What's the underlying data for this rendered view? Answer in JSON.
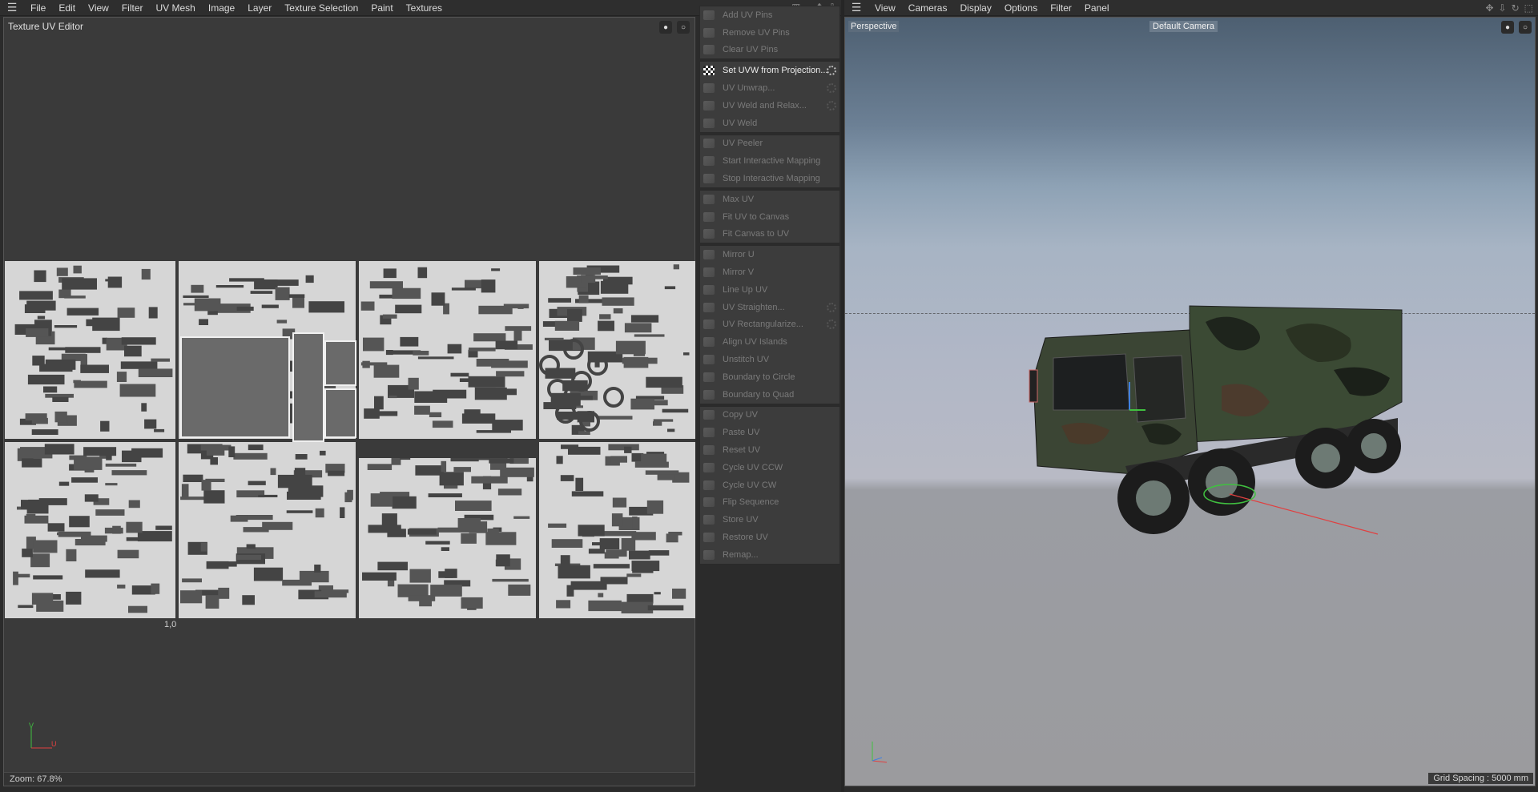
{
  "left_menu": {
    "items": [
      "File",
      "Edit",
      "View",
      "Filter",
      "UV Mesh",
      "Image",
      "Layer",
      "Texture Selection",
      "Paint",
      "Textures"
    ]
  },
  "right_menu": {
    "items": [
      "View",
      "Cameras",
      "Display",
      "Options",
      "Filter",
      "Panel"
    ]
  },
  "uv_editor": {
    "title": "Texture UV Editor",
    "coord_label": "1,0",
    "zoom_text": "Zoom: 67.8%",
    "axis_v": "V",
    "axis_u": "U"
  },
  "commands": {
    "groups": [
      [
        {
          "label": "Add UV Pins"
        },
        {
          "label": "Remove UV Pins"
        },
        {
          "label": "Clear UV Pins"
        }
      ],
      [
        {
          "label": "Set UVW from Projection...",
          "active": true,
          "gear": true
        },
        {
          "label": "UV Unwrap...",
          "gear": true
        },
        {
          "label": "UV Weld and Relax...",
          "gear": true
        },
        {
          "label": "UV Weld"
        }
      ],
      [
        {
          "label": "UV Peeler"
        },
        {
          "label": "Start Interactive Mapping"
        },
        {
          "label": "Stop Interactive Mapping"
        }
      ],
      [
        {
          "label": "Max UV"
        },
        {
          "label": "Fit UV to Canvas"
        },
        {
          "label": "Fit Canvas to UV"
        }
      ],
      [
        {
          "label": "Mirror U"
        },
        {
          "label": "Mirror V"
        },
        {
          "label": "Line Up UV"
        },
        {
          "label": "UV Straighten...",
          "gear": true
        },
        {
          "label": "UV Rectangularize...",
          "gear": true
        },
        {
          "label": "Align UV Islands"
        },
        {
          "label": "Unstitch UV"
        },
        {
          "label": "Boundary to Circle"
        },
        {
          "label": "Boundary to Quad"
        }
      ],
      [
        {
          "label": "Copy UV"
        },
        {
          "label": "Paste UV"
        },
        {
          "label": "Reset UV"
        },
        {
          "label": "Cycle UV CCW"
        },
        {
          "label": "Cycle UV CW"
        },
        {
          "label": "Flip Sequence"
        },
        {
          "label": "Store UV"
        },
        {
          "label": "Restore UV"
        },
        {
          "label": "Remap..."
        }
      ]
    ]
  },
  "viewport": {
    "title": "Perspective",
    "camera": "Default Camera",
    "grid_spacing": "Grid Spacing : 5000 mm"
  },
  "colors": {
    "accent_x": "#e04040",
    "accent_y": "#40c040",
    "accent_z": "#4080e0"
  }
}
